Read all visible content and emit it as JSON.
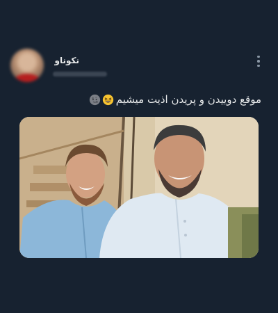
{
  "tweet": {
    "author_name": "نکوناو",
    "text": "موقع دوییدن و پریدن اذیت میشیم",
    "emojis": [
      "grinning-squinting-face-icon",
      "new-moon-face-icon"
    ]
  },
  "colors": {
    "background": "#172230",
    "text": "#e7e9ea",
    "muted": "#8b98a5"
  }
}
